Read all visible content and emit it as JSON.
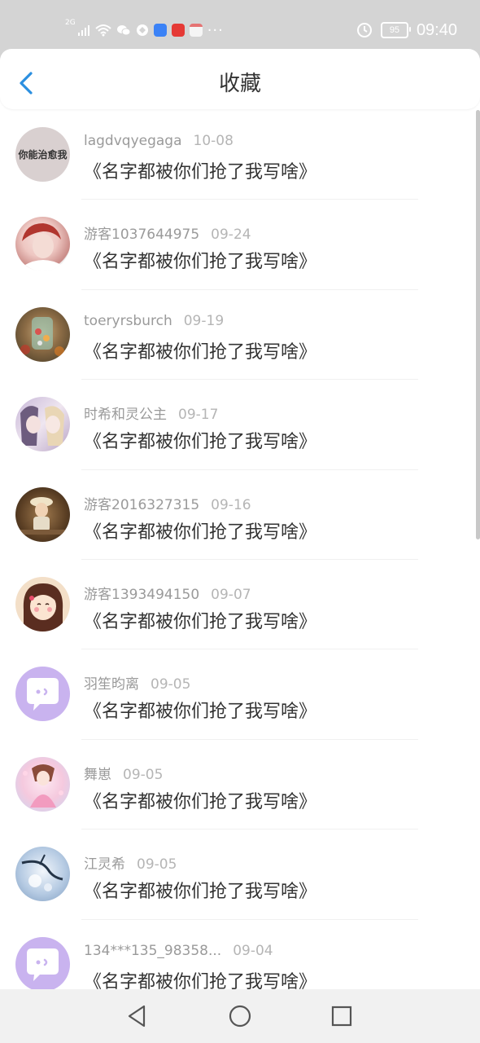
{
  "status_bar": {
    "network": "2G",
    "time": "09:40",
    "battery": "95",
    "more": "···"
  },
  "header": {
    "title": "收藏"
  },
  "favorites": [
    {
      "user": "lagdvqyegaga",
      "date": "10-08",
      "title": "《名字都被你们抢了我写啥》",
      "avatar": "text-avatar",
      "avatar_text": "你能治愈我"
    },
    {
      "user": "游客1037644975",
      "date": "09-24",
      "title": "《名字都被你们抢了我写啥》",
      "avatar": "girl-photo"
    },
    {
      "user": "toeryrsburch",
      "date": "09-19",
      "title": "《名字都被你们抢了我写啥》",
      "avatar": "jar-photo"
    },
    {
      "user": "时希和灵公主",
      "date": "09-17",
      "title": "《名字都被你们抢了我写啥》",
      "avatar": "anime-pair"
    },
    {
      "user": "游客2016327315",
      "date": "09-16",
      "title": "《名字都被你们抢了我写啥》",
      "avatar": "child-photo"
    },
    {
      "user": "游客1393494150",
      "date": "09-07",
      "title": "《名字都被你们抢了我写啥》",
      "avatar": "cartoon-girl"
    },
    {
      "user": "羽笙昀离",
      "date": "09-05",
      "title": "《名字都被你们抢了我写啥》",
      "avatar": "chat-bubble"
    },
    {
      "user": "舞崽",
      "date": "09-05",
      "title": "《名字都被你们抢了我写啥》",
      "avatar": "anime-dancer"
    },
    {
      "user": "江灵希",
      "date": "09-05",
      "title": "《名字都被你们抢了我写啥》",
      "avatar": "winter-scene"
    },
    {
      "user": "134***135_98358...",
      "date": "09-04",
      "title": "《名字都被你们抢了我写啥》",
      "avatar": "chat-bubble"
    }
  ],
  "colors": {
    "accent": "#2b8fe0",
    "status_bar": "#d4d4d4",
    "default_avatar": "#c9b3ef"
  },
  "nav": {
    "back_icon": "triangle-back-icon",
    "home_icon": "circle-home-icon",
    "recents_icon": "square-recents-icon"
  }
}
